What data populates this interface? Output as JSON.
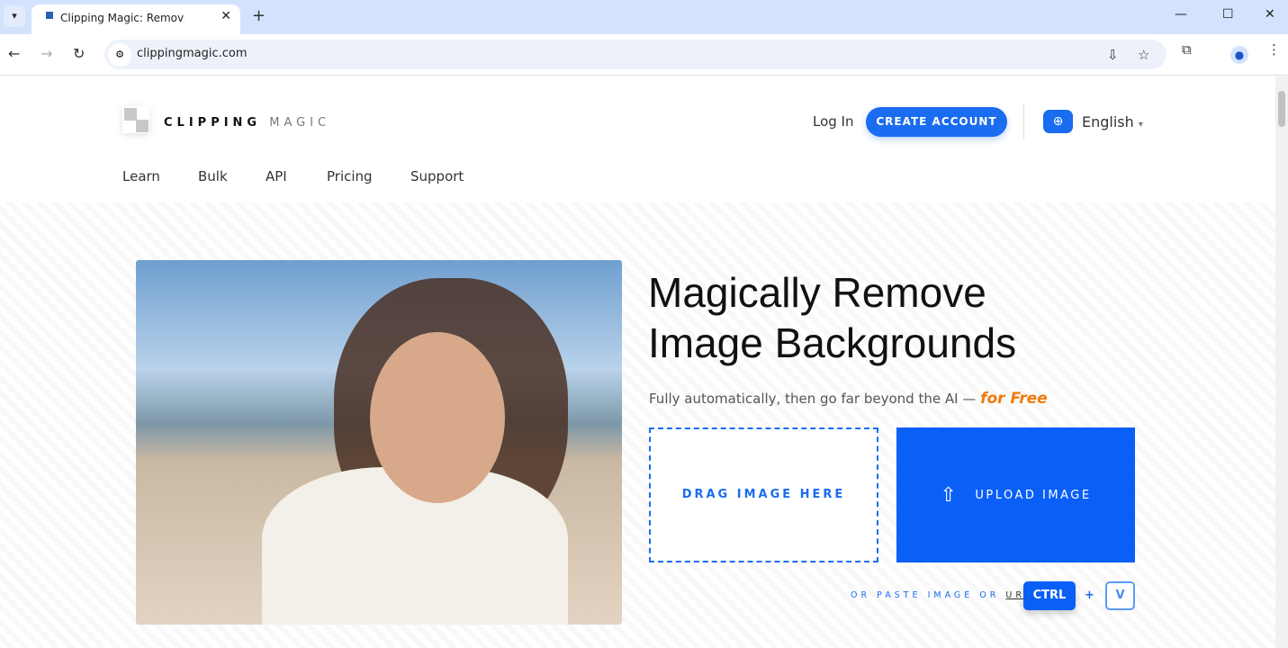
{
  "browser": {
    "tab_title": "Clipping Magic: Remove Background",
    "url": "clippingmagic.com"
  },
  "header": {
    "brand_bold": "CLIPPING",
    "brand_light": "MAGIC",
    "login": "Log In",
    "create_account": "CREATE ACCOUNT",
    "language": "English"
  },
  "nav": [
    "Learn",
    "Bulk",
    "API",
    "Pricing",
    "Support"
  ],
  "hero": {
    "title_line1": "Magically Remove",
    "title_line2": "Image Backgrounds",
    "subtitle": "Fully automatically, then go far beyond the AI —",
    "subtitle_emphasis": "for Free",
    "drag": "DRAG IMAGE HERE",
    "upload": "UPLOAD IMAGE",
    "paste": "OR PASTE IMAGE OR",
    "url_link": "URL",
    "ctrl": "CTRL",
    "plus": "+",
    "v": "V"
  },
  "colors": {
    "accent": "#1a6cf0",
    "emphasis": "#f07a0a"
  }
}
